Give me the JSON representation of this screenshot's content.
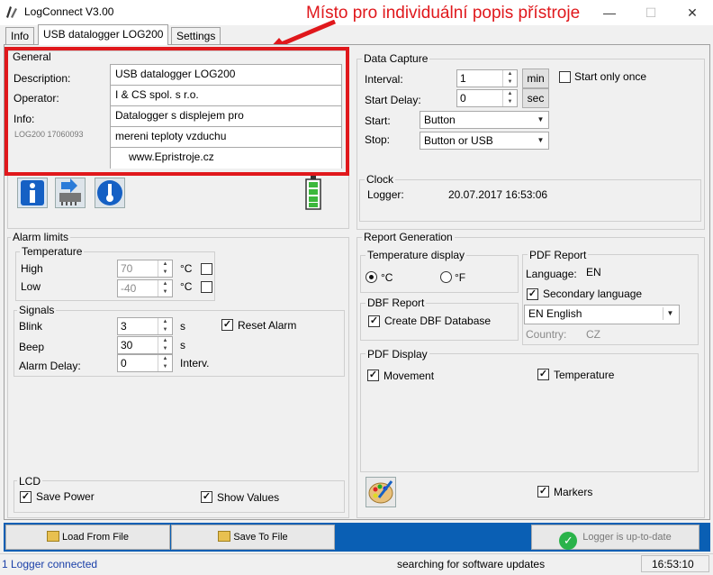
{
  "window": {
    "title": "LogConnect V3.00",
    "controls": {
      "minimize": "—",
      "maximize": "☐",
      "close": "✕"
    }
  },
  "annotation": "Místo pro individuální popis přístroje",
  "tabs": [
    "Info",
    "USB datalogger LOG200",
    "Settings"
  ],
  "general": {
    "title": "General",
    "description_label": "Description:",
    "operator_label": "Operator:",
    "info_label": "Info:",
    "serial": "LOG200 17060093",
    "description": "USB datalogger LOG200",
    "operator": "I & CS spol. s r.o.",
    "info_lines": [
      "Datalogger s displejem pro",
      "mereni teploty vzduchu",
      "www.Epristroje.cz"
    ]
  },
  "data_capture": {
    "title": "Data Capture",
    "interval_label": "Interval:",
    "interval": "1",
    "interval_unit": "min",
    "start_delay_label": "Start Delay:",
    "start_delay": "0",
    "start_delay_unit": "sec",
    "start_only_once": "Start only once",
    "start_label": "Start:",
    "start_value": "Button",
    "stop_label": "Stop:",
    "stop_value": "Button or USB"
  },
  "clock": {
    "title": "Clock",
    "logger_label": "Logger:",
    "logger_time": "20.07.2017 16:53:06"
  },
  "alarm_limits": {
    "title": "Alarm limits",
    "temperature_title": "Temperature",
    "high_label": "High",
    "high_value": "70",
    "high_unit": "°C",
    "low_label": "Low",
    "low_value": "-40",
    "low_unit": "°C"
  },
  "signals": {
    "title": "Signals",
    "blink_label": "Blink",
    "blink_value": "3",
    "blink_unit": "s",
    "beep_label": "Beep",
    "beep_value": "30",
    "beep_unit": "s",
    "alarm_delay_label": "Alarm Delay:",
    "alarm_delay_value": "0",
    "alarm_delay_unit": "Interv.",
    "reset_alarm": "Reset Alarm"
  },
  "lcd": {
    "title": "LCD",
    "save_power": "Save Power",
    "show_values": "Show Values"
  },
  "report_generation": {
    "title": "Report Generation",
    "temperature_display_title": "Temperature display",
    "celsius": "°C",
    "fahrenheit": "°F",
    "dbf_title": "DBF Report",
    "create_dbf": "Create DBF Database",
    "pdf_report_title": "PDF Report",
    "language_label": "Language:",
    "language_value": "EN",
    "secondary_language": "Secondary language",
    "secondary_language_value": "EN  English",
    "country_label": "Country:",
    "country_value": "CZ",
    "pdf_display_title": "PDF Display",
    "movement": "Movement",
    "temperature": "Temperature",
    "markers": "Markers"
  },
  "bottom": {
    "load": "Load From File",
    "save": "Save To File",
    "status": "Logger is up-to-date"
  },
  "statusbar": {
    "connection": "1 Logger connected",
    "updates": "searching for software updates",
    "time": "16:53:10"
  }
}
